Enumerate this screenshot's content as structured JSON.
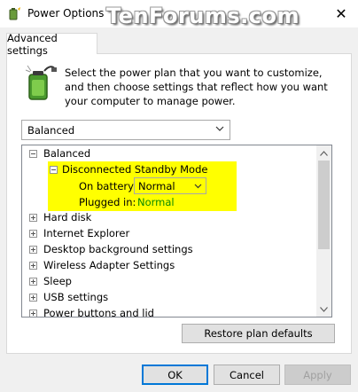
{
  "window": {
    "title": "Power Options",
    "watermark": "TenForums.com",
    "close_glyph": "✕"
  },
  "tab": {
    "label": "Advanced settings"
  },
  "description": "Select the power plan that you want to customize, and then choose settings that reflect how you want your computer to manage power.",
  "plan_dropdown": {
    "selected": "Balanced"
  },
  "tree": {
    "root": "Balanced",
    "expanded_item": "Disconnected Standby Mode",
    "on_battery_label": "On battery:",
    "on_battery_value": "Normal",
    "plugged_in_label": "Plugged in:",
    "plugged_in_value": "Normal",
    "items": [
      "Hard disk",
      "Internet Explorer",
      "Desktop background settings",
      "Wireless Adapter Settings",
      "Sleep",
      "USB settings",
      "Power buttons and lid"
    ]
  },
  "buttons": {
    "restore": "Restore plan defaults",
    "ok": "OK",
    "cancel": "Cancel",
    "apply": "Apply"
  },
  "colors": {
    "highlight": "#ffff00",
    "plugged_value": "#0a8a00",
    "ok_border": "#0078d7"
  },
  "icons": [
    "power-options-icon",
    "battery-plug-icon",
    "chevron-down-icon",
    "scroll-up-arrow-icon",
    "scroll-down-arrow-icon"
  ]
}
